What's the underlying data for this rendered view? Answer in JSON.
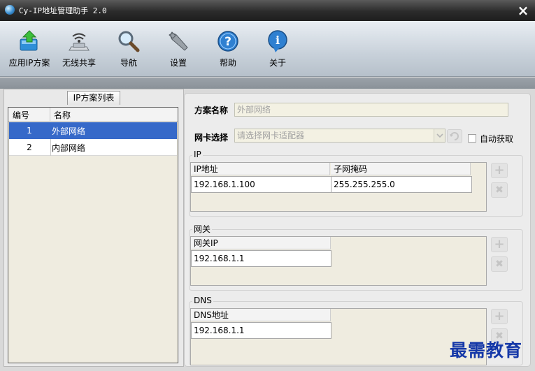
{
  "window": {
    "title": "Cy-IP地址管理助手 2.0",
    "close_glyph": "×"
  },
  "toolbar": {
    "items": [
      {
        "label": "应用IP方案",
        "icon": "apply-scheme-icon"
      },
      {
        "label": "无线共享",
        "icon": "wireless-share-icon"
      },
      {
        "label": "导航",
        "icon": "magnifier-icon"
      },
      {
        "label": "设置",
        "icon": "wrench-icon"
      },
      {
        "label": "帮助",
        "icon": "help-icon"
      },
      {
        "label": "关于",
        "icon": "info-icon"
      }
    ]
  },
  "scheme_list": {
    "caption": "IP方案列表",
    "columns": [
      "编号",
      "名称"
    ],
    "rows": [
      {
        "num": "1",
        "name": "外部网络",
        "selected": true
      },
      {
        "num": "2",
        "name": "内部网络",
        "selected": false
      }
    ]
  },
  "form": {
    "scheme_name_label": "方案名称",
    "scheme_name_value": "外部网络",
    "nic_label": "网卡选择",
    "nic_placeholder": "请选择网卡适配器",
    "auto_obtain_label": "自动获取",
    "auto_obtain_checked": false
  },
  "ip_group": {
    "title": "IP",
    "columns": [
      "IP地址",
      "子网掩码"
    ],
    "rows": [
      {
        "ip": "192.168.1.100",
        "mask": "255.255.255.0"
      }
    ]
  },
  "gateway_group": {
    "title": "网关",
    "column": "网关IP",
    "rows": [
      {
        "ip": "192.168.1.1"
      }
    ]
  },
  "dns_group": {
    "title": "DNS",
    "column": "DNS地址",
    "rows": [
      {
        "ip": "192.168.1.1"
      }
    ]
  },
  "side_buttons": {
    "add": "+",
    "remove": "✖"
  },
  "watermark": "最需教育",
  "colors": {
    "selection": "#3669c9",
    "watermark": "#1538a8",
    "title_bar": "#2b2b2b"
  }
}
